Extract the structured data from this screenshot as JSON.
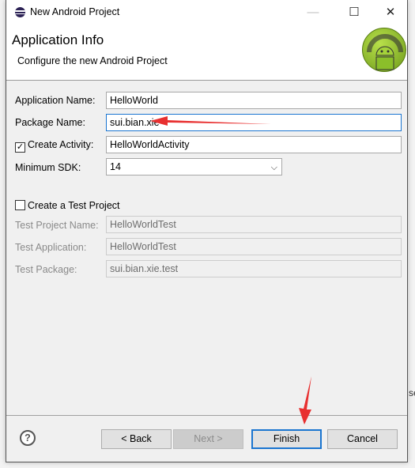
{
  "window": {
    "title": "New Android Project"
  },
  "header": {
    "title": "Application Info",
    "subtitle": "Configure the new Android Project"
  },
  "form": {
    "app_name": {
      "label": "Application Name:",
      "value": "HelloWorld"
    },
    "package_name": {
      "label": "Package Name:",
      "value": "sui.bian.xie"
    },
    "create_activity": {
      "label": "Create Activity:",
      "checked": true,
      "value": "HelloWorldActivity"
    },
    "min_sdk": {
      "label": "Minimum SDK:",
      "value": "14"
    },
    "create_test": {
      "label": "Create a Test Project",
      "checked": false
    },
    "test_project_name": {
      "label": "Test Project Name:",
      "value": "HelloWorldTest"
    },
    "test_application": {
      "label": "Test Application:",
      "value": "HelloWorldTest"
    },
    "test_package": {
      "label": "Test Package:",
      "value": "sui.bian.xie.test"
    }
  },
  "buttons": {
    "back": "< Back",
    "next": "Next >",
    "finish": "Finish",
    "cancel": "Cancel"
  },
  "background_text": "se",
  "colors": {
    "accent": "#1a75d0",
    "annotation_arrow": "#e83030"
  },
  "icons": [
    "eclipse-icon",
    "minimize-icon",
    "maximize-icon",
    "close-icon",
    "android-logo-icon",
    "help-icon",
    "chevron-down-icon"
  ]
}
